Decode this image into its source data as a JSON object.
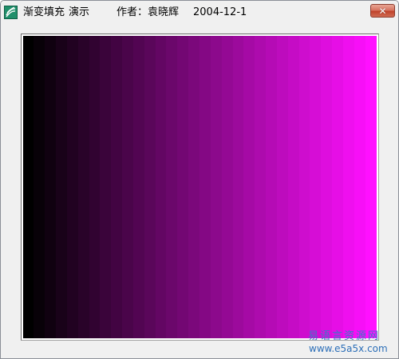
{
  "window": {
    "title": "渐变填充",
    "title_demo": "演示",
    "title_author": "作者：袁晓辉",
    "title_date": "2004-12-1",
    "close_glyph": "✕"
  },
  "gradient": {
    "direction": "left-to-right",
    "start_color": "#000000",
    "end_color": "#ff10ff",
    "steps": 32
  },
  "watermark": {
    "text": "易语言资源网",
    "url": "www.e5a5x.com"
  }
}
